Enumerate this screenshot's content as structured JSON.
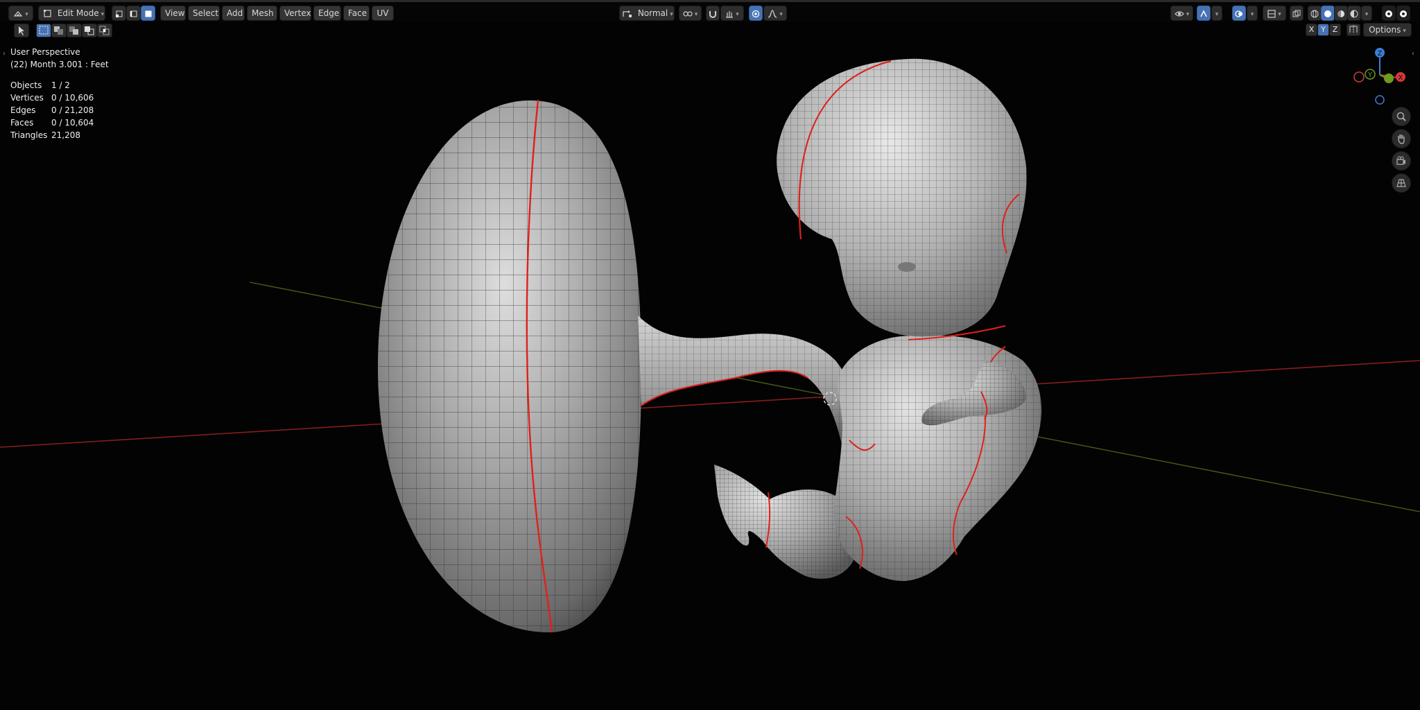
{
  "header": {
    "mode_label": "Edit Mode",
    "menus": [
      "View",
      "Select",
      "Add",
      "Mesh",
      "Vertex",
      "Edge",
      "Face",
      "UV"
    ],
    "orientation_label": "Normal",
    "options_label": "Options",
    "axis_toggles": [
      "X",
      "Y",
      "Z"
    ]
  },
  "overlay": {
    "view_name": "User Perspective",
    "object_info": "(22) Month 3.001 : Feet"
  },
  "stats": [
    {
      "label": "Objects",
      "value": "1 / 2"
    },
    {
      "label": "Vertices",
      "value": "0 / 10,606"
    },
    {
      "label": "Edges",
      "value": "0 / 21,208"
    },
    {
      "label": "Faces",
      "value": "0 / 10,604"
    },
    {
      "label": "Triangles",
      "value": "21,208"
    }
  ],
  "gizmo": {
    "z_label": "Z",
    "y_label": "Y",
    "x_label": "X"
  },
  "colors": {
    "accent": "#4772b3",
    "seam": "#e0201a",
    "x_axis": "#d23838",
    "y_axis": "#6e9a1e",
    "z_axis": "#3a7fd5"
  }
}
